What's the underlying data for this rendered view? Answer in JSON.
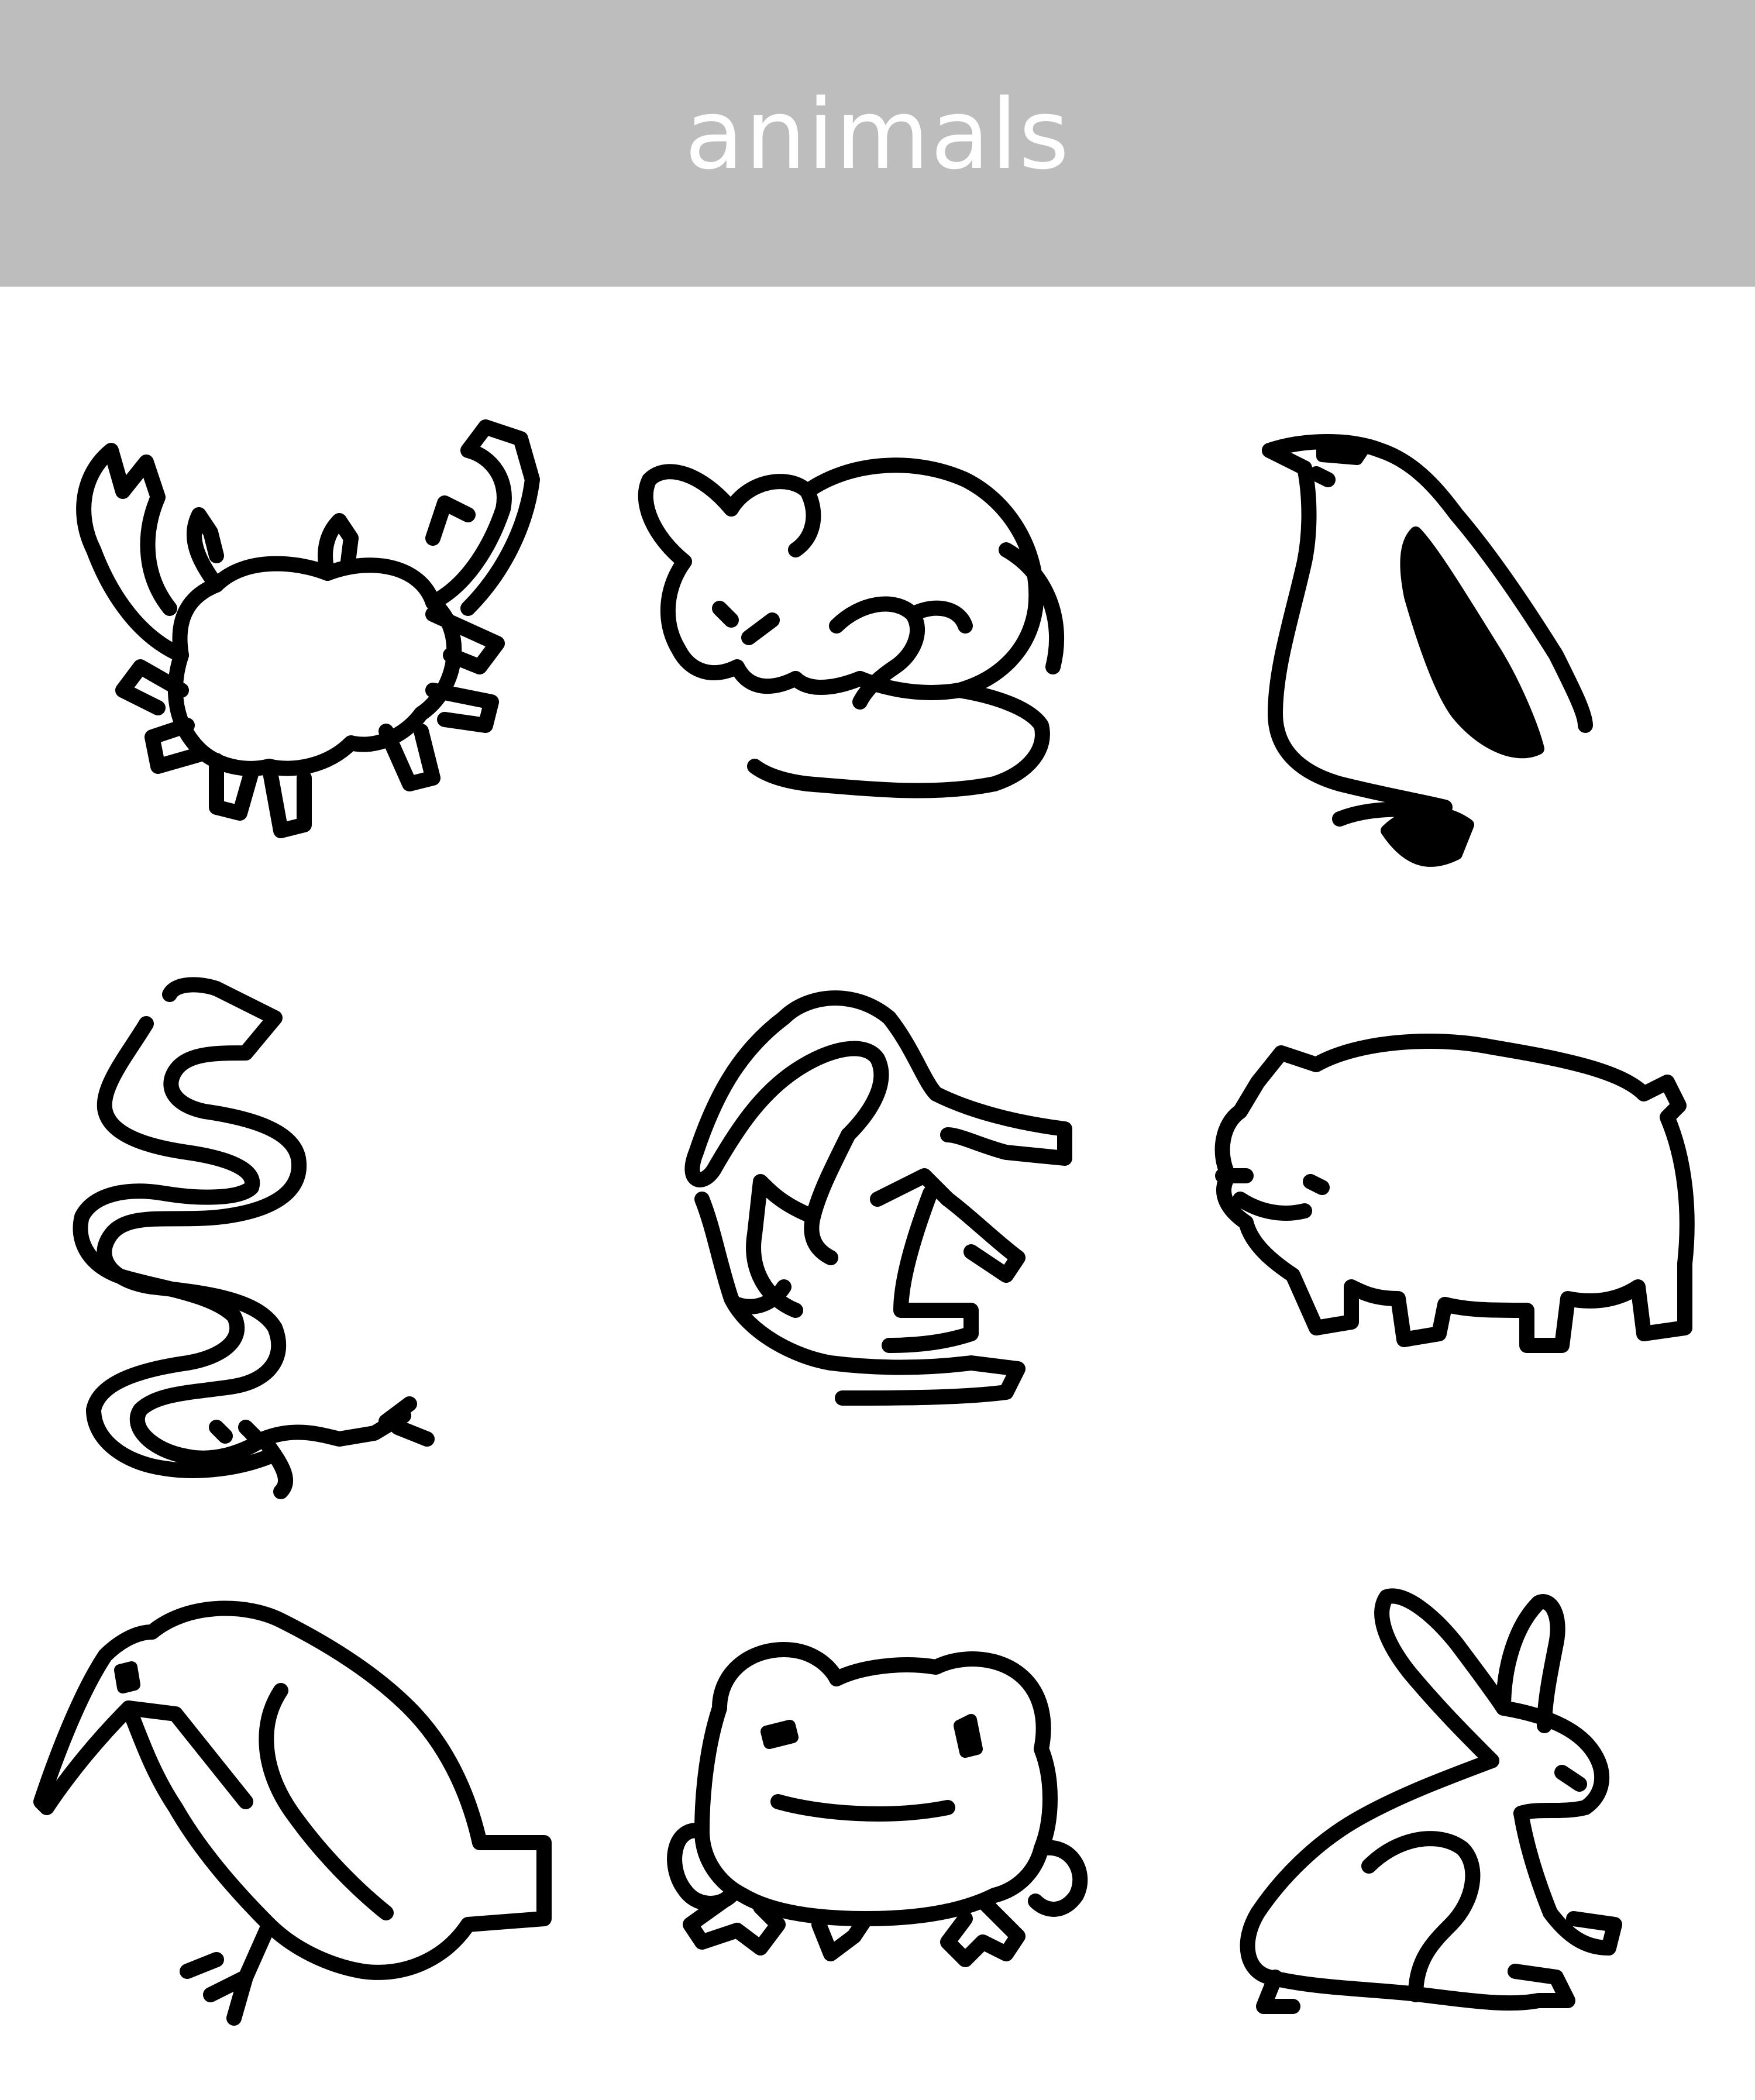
{
  "header": {
    "title": "animals",
    "background": "#bdbdbd",
    "text_color": "#ffffff"
  },
  "icons": [
    {
      "name": "crab-icon"
    },
    {
      "name": "mouse-icon"
    },
    {
      "name": "penguin-icon"
    },
    {
      "name": "snake-icon"
    },
    {
      "name": "kangaroo-icon"
    },
    {
      "name": "bear-icon"
    },
    {
      "name": "crow-icon"
    },
    {
      "name": "frog-icon"
    },
    {
      "name": "rabbit-icon"
    }
  ]
}
